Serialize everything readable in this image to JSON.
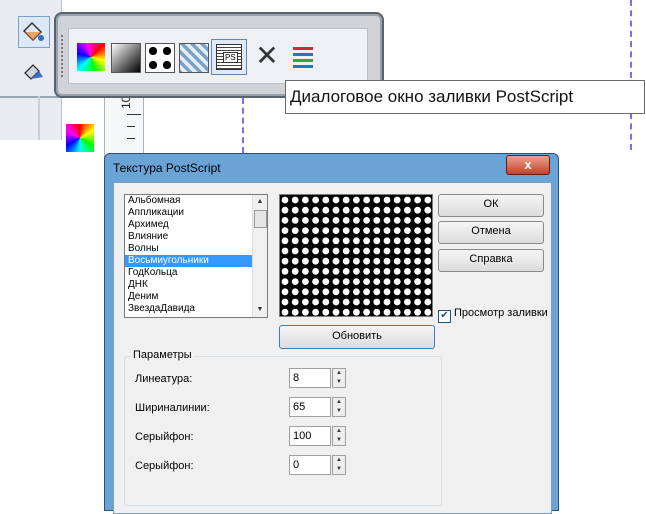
{
  "tooltip": "Диалоговое окно заливки PostScript",
  "ruler_label": "100",
  "toolbar_icons": [
    "uniform-fill-icon",
    "fountain-fill-icon",
    "two-color-pattern-icon",
    "texture-fill-icon",
    "postscript-fill-icon",
    "no-fill-icon",
    "color-docker-icon"
  ],
  "dialog": {
    "title": "Текстура PostScript",
    "close": "x",
    "textures": [
      "Альбомная",
      "Аппликации",
      "Архимед",
      "Влияние",
      "Волны",
      "Восьмиугольники",
      "ГодКольца",
      "ДНК",
      "Деним",
      "ЗвездаДавида"
    ],
    "selected_index": 5,
    "ok": "ОК",
    "cancel": "Отмена",
    "help": "Справка",
    "preview_check": "Просмотр заливки",
    "refresh": "Обновить",
    "params_title": "Параметры",
    "params": [
      {
        "label": "Линеатура:",
        "value": "8"
      },
      {
        "label": "Ширинaлинии:",
        "value": "65"
      },
      {
        "label": "Серыйфон:",
        "value": "100"
      },
      {
        "label": "Серыйфон:",
        "value": "0"
      }
    ]
  }
}
